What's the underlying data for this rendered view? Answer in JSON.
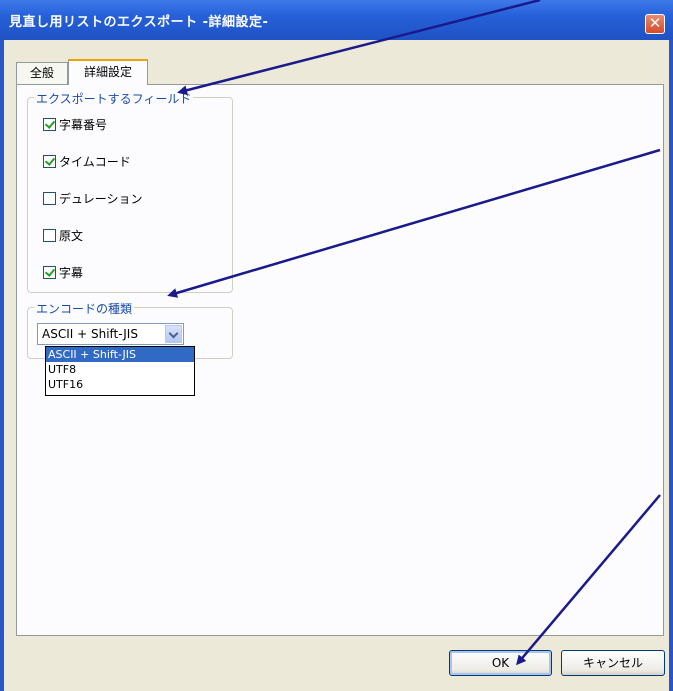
{
  "window": {
    "title": "見直し用リストのエクスポート -詳細設定-",
    "close_symbol": "✕"
  },
  "tabs": [
    {
      "label": "全般",
      "active": false
    },
    {
      "label": "詳細設定",
      "active": true
    }
  ],
  "fields_group": {
    "legend": "エクスポートするフィールド",
    "items": [
      {
        "label": "字幕番号",
        "checked": true
      },
      {
        "label": "タイムコード",
        "checked": true
      },
      {
        "label": "デュレーション",
        "checked": false
      },
      {
        "label": "原文",
        "checked": false
      },
      {
        "label": "字幕",
        "checked": true
      }
    ]
  },
  "encoding_group": {
    "legend": "エンコードの種類",
    "selected": "ASCII + Shift-JIS",
    "options": [
      "ASCII + Shift-JIS",
      "UTF8",
      "UTF16"
    ]
  },
  "buttons": {
    "ok": "OK",
    "cancel": "キャンセル"
  },
  "colors": {
    "titlebar": "#2660d8",
    "dialog_bg": "#ece9d8",
    "group_legend": "#1b4ca8",
    "selection": "#316ac5",
    "annotation_arrow": "#1a1a8c"
  }
}
